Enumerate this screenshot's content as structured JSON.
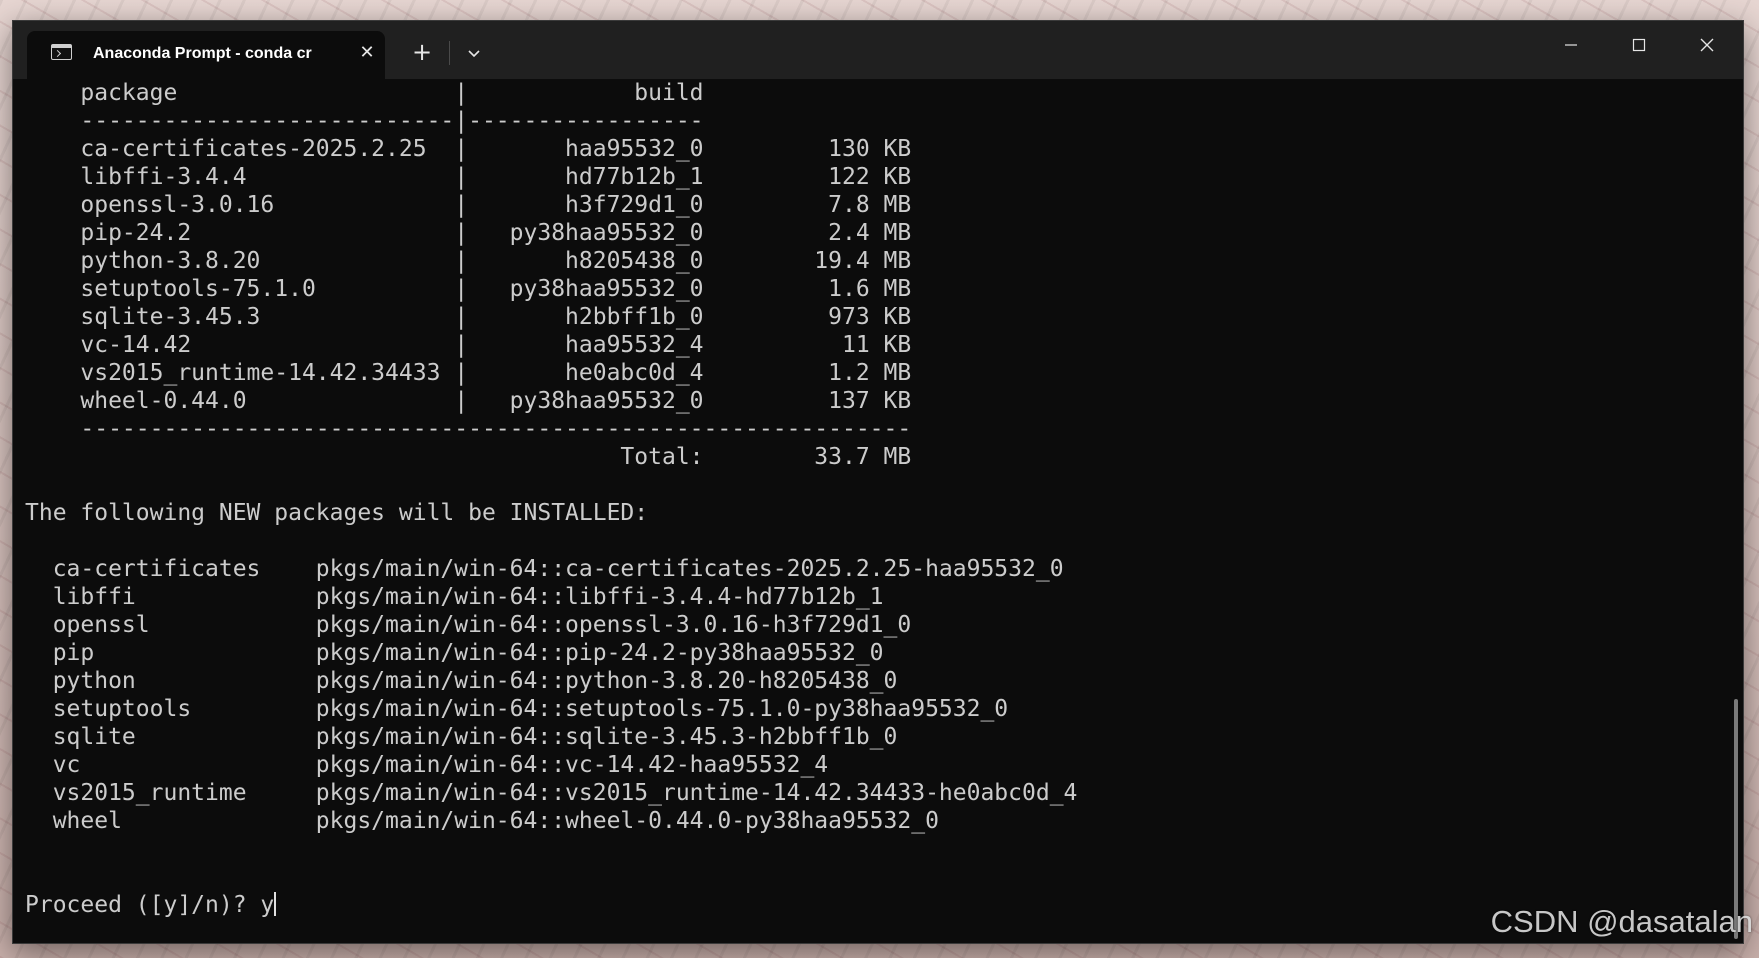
{
  "window": {
    "tab_title": "Anaconda Prompt - conda  cr",
    "tab_close_glyph": "✕",
    "new_tab_glyph": "+"
  },
  "console": {
    "lines": [
      "    package                    |            build",
      "    ---------------------------|-----------------",
      "    ca-certificates-2025.2.25  |       haa95532_0         130 KB",
      "    libffi-3.4.4               |       hd77b12b_1         122 KB",
      "    openssl-3.0.16             |       h3f729d1_0         7.8 MB",
      "    pip-24.2                   |   py38haa95532_0         2.4 MB",
      "    python-3.8.20              |       h8205438_0        19.4 MB",
      "    setuptools-75.1.0          |   py38haa95532_0         1.6 MB",
      "    sqlite-3.45.3              |       h2bbff1b_0         973 KB",
      "    vc-14.42                   |       haa95532_4          11 KB",
      "    vs2015_runtime-14.42.34433 |       he0abc0d_4         1.2 MB",
      "    wheel-0.44.0               |   py38haa95532_0         137 KB",
      "    ------------------------------------------------------------",
      "                                           Total:        33.7 MB",
      "",
      "The following NEW packages will be INSTALLED:",
      "",
      "  ca-certificates    pkgs/main/win-64::ca-certificates-2025.2.25-haa95532_0",
      "  libffi             pkgs/main/win-64::libffi-3.4.4-hd77b12b_1",
      "  openssl            pkgs/main/win-64::openssl-3.0.16-h3f729d1_0",
      "  pip                pkgs/main/win-64::pip-24.2-py38haa95532_0",
      "  python             pkgs/main/win-64::python-3.8.20-h8205438_0",
      "  setuptools         pkgs/main/win-64::setuptools-75.1.0-py38haa95532_0",
      "  sqlite             pkgs/main/win-64::sqlite-3.45.3-h2bbff1b_0",
      "  vc                 pkgs/main/win-64::vc-14.42-haa95532_4",
      "  vs2015_runtime     pkgs/main/win-64::vs2015_runtime-14.42.34433-he0abc0d_4",
      "  wheel              pkgs/main/win-64::wheel-0.44.0-py38haa95532_0",
      "",
      ""
    ],
    "prompt": "Proceed ([y]/n)? y"
  },
  "watermark": "CSDN @dasatalan",
  "icons": {
    "tab_icon": "terminal-icon",
    "close": "close-icon",
    "new_tab": "plus-icon",
    "dropdown": "chevron-down-icon",
    "minimize": "minimize-icon",
    "maximize": "maximize-icon",
    "window_close": "window-close-icon"
  },
  "colors": {
    "console_bg": "#0c0c0c",
    "console_fg": "#cccccc",
    "titlebar_bg": "#202020"
  }
}
